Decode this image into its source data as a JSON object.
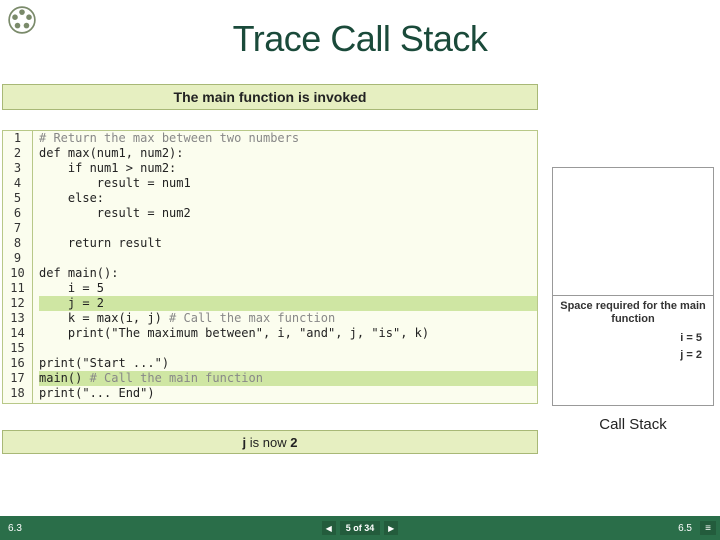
{
  "title": "Trace Call Stack",
  "banner": "The main function is invoked",
  "lineNumbers": [
    "1",
    "2",
    "3",
    "4",
    "5",
    "6",
    "7",
    "8",
    "9",
    "10",
    "11",
    "12",
    "13",
    "14",
    "15",
    "16",
    "17",
    "18"
  ],
  "code": {
    "l1": "# Return the max between two numbers",
    "l2": "def max(num1, num2):",
    "l3": "    if num1 > num2:",
    "l4": "        result = num1",
    "l5": "    else:",
    "l6": "        result = num2",
    "l7": "",
    "l8": "    return result",
    "l9": "",
    "l10": "def main():",
    "l11": "    i = 5",
    "l12": "    j = 2",
    "l13a": "    k = max(i, j) ",
    "l13b": "# Call the max function",
    "l14": "    print(\"The maximum between\", i, \"and\", j, \"is\", k)",
    "l15": "",
    "l16": "print(\"Start ...\")",
    "l17a": "main() ",
    "l17b": "# Call the main function",
    "l18": "print(\"... End\")"
  },
  "frame": {
    "title": "Space required for the main function",
    "v1": "i = 5",
    "v2": "j = 2"
  },
  "stackLabel": "Call Stack",
  "status": {
    "a": "j",
    "b": " is now ",
    "c": "2"
  },
  "footer": {
    "page": "6.3",
    "pos": "5 of 34",
    "ref": "6.5"
  }
}
